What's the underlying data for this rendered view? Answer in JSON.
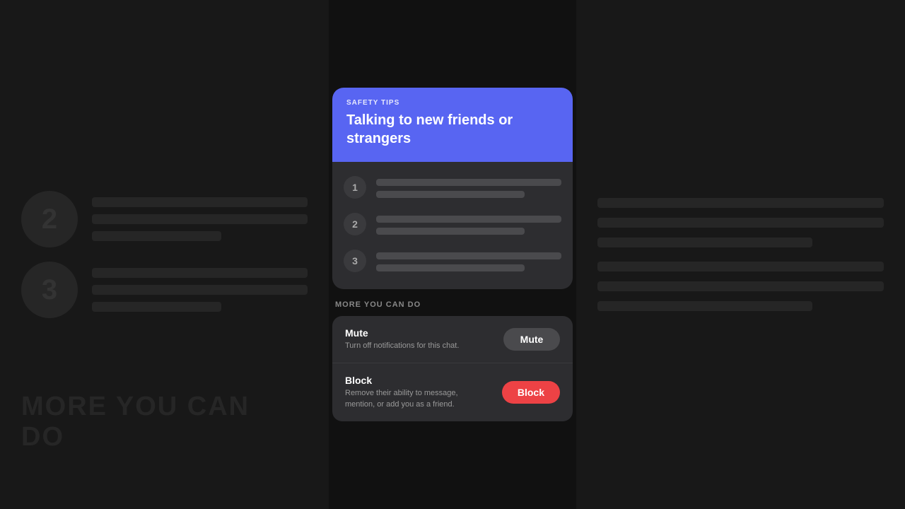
{
  "background": {
    "left": {
      "items": [
        {
          "number": "2"
        },
        {
          "number": "3"
        }
      ]
    },
    "bottom_text": "MORE YOU CAN",
    "bottom_text2": "do"
  },
  "header": {
    "safety_label": "SAFETY TIPS",
    "title": "Talking to new friends or strangers"
  },
  "tips": [
    {
      "number": "1"
    },
    {
      "number": "2"
    },
    {
      "number": "3"
    }
  ],
  "more_section": {
    "label": "MORE YOU CAN DO",
    "actions": [
      {
        "title": "Mute",
        "description": "Turn off notifications for this chat.",
        "button_label": "Mute",
        "button_type": "mute"
      },
      {
        "title": "Block",
        "description": "Remove their ability to message, mention, or add you as a friend.",
        "button_label": "Block",
        "button_type": "block"
      }
    ]
  }
}
